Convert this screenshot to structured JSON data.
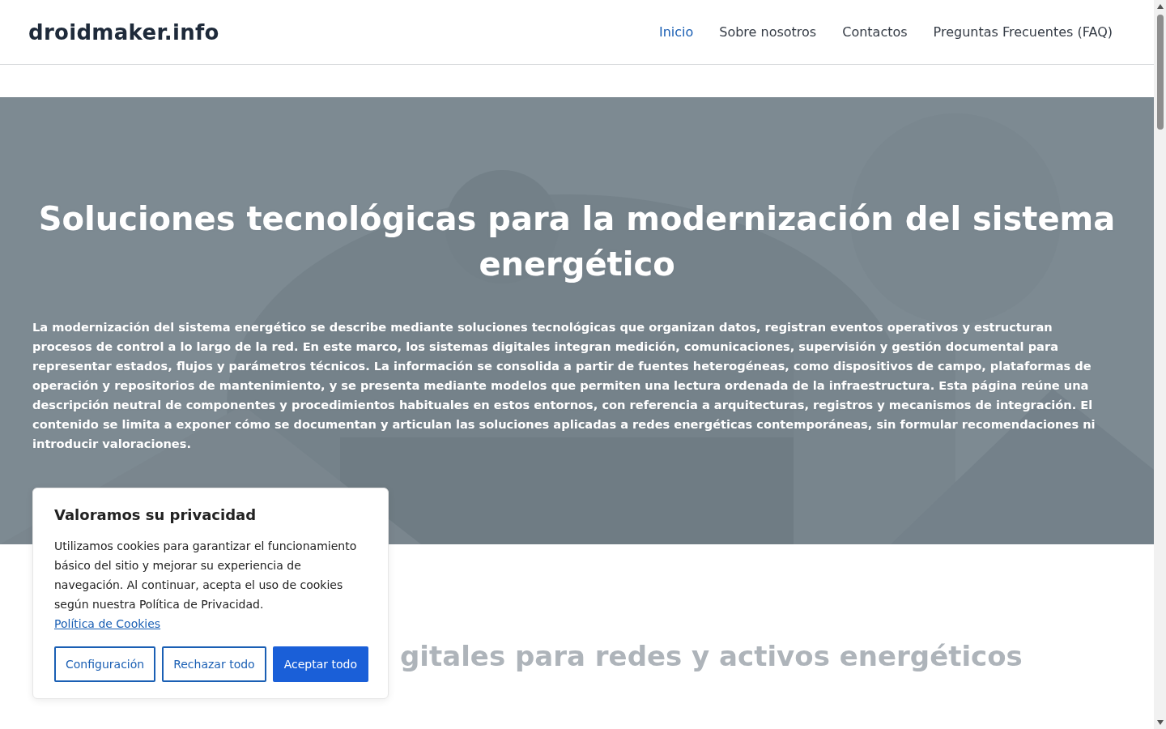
{
  "header": {
    "logo": "droidmaker.info",
    "nav": [
      {
        "label": "Inicio",
        "selected": true
      },
      {
        "label": "Sobre nosotros",
        "selected": false
      },
      {
        "label": "Contactos",
        "selected": false
      },
      {
        "label": "Preguntas Frecuentes (FAQ)",
        "selected": false
      }
    ]
  },
  "hero": {
    "title": "Soluciones tecnológicas para la modernización del sistema energético",
    "text": "La modernización del sistema energético se describe mediante soluciones tecnológicas que organizan datos, registran eventos operativos y estructuran procesos de control a lo largo de la red. En este marco, los sistemas digitales integran medición, comunicaciones, supervisión y gestión documental para representar estados, flujos y parámetros técnicos. La información se consolida a partir de fuentes heterogéneas, como dispositivos de campo, plataformas de operación y repositorios de mantenimiento, y se presenta mediante modelos que permiten una lectura ordenada de la infraestructura. Esta página reúne una descripción neutral de componentes y procedimientos habituales en estos entornos, con referencia a arquitecturas, registros y mecanismos de integración. El contenido se limita a exponer cómo se documentan y articulan las soluciones aplicadas a redes energéticas contemporáneas, sin formular recomendaciones ni introducir valoraciones."
  },
  "section": {
    "title": "gitales para redes y activos energéticos"
  },
  "cookie_banner": {
    "title": "Valoramos su privacidad",
    "text": "Utilizamos cookies para garantizar el funcionamiento básico del sitio y mejorar su experiencia de navegación. Al continuar, acepta el uso de cookies según nuestra Política de Privacidad.",
    "link": "Política de Cookies",
    "buttons": [
      {
        "label": "Configuración",
        "kind": "outline"
      },
      {
        "label": "Rechazar todo",
        "kind": "outline"
      },
      {
        "label": "Aceptar todo",
        "kind": "primary"
      }
    ]
  }
}
